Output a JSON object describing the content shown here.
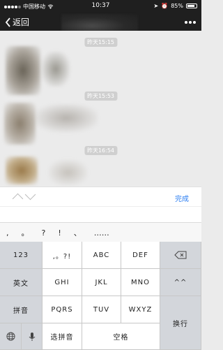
{
  "status_bar": {
    "carrier": "中国移动",
    "time": "10:37",
    "battery": "85%",
    "battery_level": 0.85
  },
  "nav": {
    "back_label": "返回"
  },
  "chat": {
    "timestamps": [
      "昨天15:15",
      "昨天15:53",
      "昨天16:54"
    ]
  },
  "toolbar": {
    "done_label": "完成"
  },
  "candidates": [
    ",",
    "。",
    "?",
    "!",
    "、",
    "……"
  ],
  "keyboard": {
    "k_123": "123",
    "k_punct": ",。?!",
    "k_abc": "ABC",
    "k_def": "DEF",
    "k_en": "英文",
    "k_ghi": "GHI",
    "k_jkl": "JKL",
    "k_mno": "MNO",
    "k_face": "^^",
    "k_pinyin": "拼音",
    "k_pqrs": "PQRS",
    "k_tuv": "TUV",
    "k_wxyz": "WXYZ",
    "k_select": "选拼音",
    "k_space": "空格",
    "k_enter": "换行"
  },
  "colors": {
    "accent": "#2d7ff2",
    "bar": "#1f1f1f",
    "chat_bg": "#ebebeb"
  }
}
